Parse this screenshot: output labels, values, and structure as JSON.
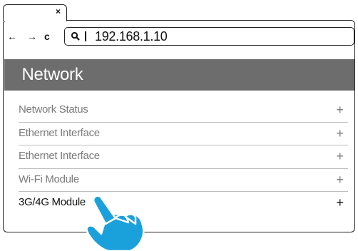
{
  "browser": {
    "tab": {
      "close_icon": "close-icon"
    },
    "toolbar": {
      "back_icon": "arrow-left-icon",
      "back_glyph": "←",
      "forward_icon": "arrow-right-icon",
      "forward_glyph": "→",
      "reload_icon": "reload-icon",
      "reload_glyph": "c",
      "search_icon": "search-icon",
      "address": "192.168.1.10"
    }
  },
  "page": {
    "title": "Network",
    "header_color": "#6d6d6d",
    "menu": [
      {
        "label": "Network Status",
        "expand": "+"
      },
      {
        "label": "Ethernet Interface",
        "expand": "+"
      },
      {
        "label": "Ethernet Interface",
        "expand": "+"
      },
      {
        "label": "Wi-Fi Module",
        "expand": "+"
      },
      {
        "label": "3G/4G Module",
        "expand": "+"
      }
    ],
    "active_item": "3G/4G Module"
  },
  "pointer": {
    "icon": "hand-pointer-icon",
    "color": "#1aa1dc"
  }
}
